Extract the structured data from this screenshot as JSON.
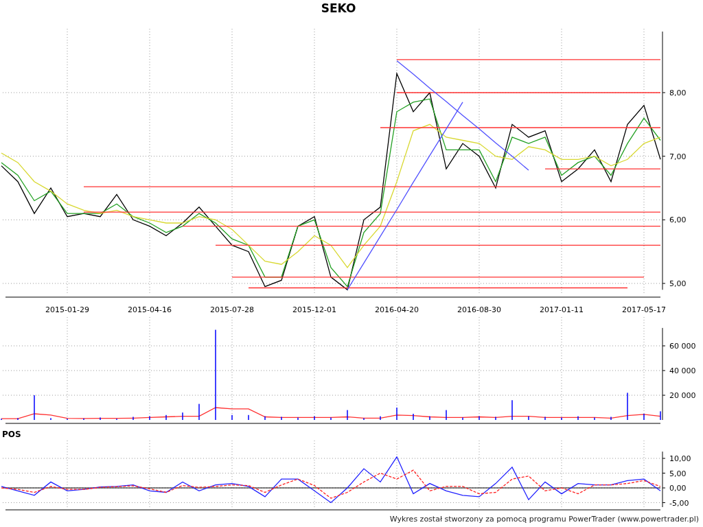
{
  "price_chart": {
    "chart_data": {
      "type": "line",
      "title": "SEKO",
      "grid": true,
      "ylim": [
        4.9,
        8.96
      ],
      "categories": [
        null,
        null,
        null,
        null,
        "2015-01-29",
        null,
        null,
        null,
        null,
        "2015-04-16",
        null,
        null,
        null,
        null,
        "2015-07-28",
        null,
        null,
        null,
        null,
        "2015-12-01",
        null,
        null,
        null,
        null,
        "2016-04-20",
        null,
        null,
        null,
        null,
        "2016-08-30",
        null,
        null,
        null,
        null,
        "2017-01-11",
        null,
        null,
        null,
        null,
        "2017-05-17",
        null
      ],
      "yticks": [
        {
          "value": 5,
          "label": "5,00"
        },
        {
          "value": 6,
          "label": "6,00"
        },
        {
          "value": 7,
          "label": "7,00"
        },
        {
          "value": 8,
          "label": "8,00"
        }
      ],
      "series": [
        {
          "color": "#000000",
          "values": [
            6.85,
            6.6,
            6.1,
            6.5,
            6.05,
            6.1,
            6.05,
            6.4,
            6.0,
            5.9,
            5.75,
            5.95,
            6.2,
            5.9,
            5.6,
            5.5,
            4.95,
            5.05,
            5.9,
            6.05,
            5.1,
            4.9,
            6.0,
            6.2,
            8.3,
            7.7,
            8.0,
            6.8,
            7.2,
            7.0,
            6.5,
            7.5,
            7.3,
            7.4,
            6.6,
            6.8,
            7.1,
            6.6,
            7.5,
            7.8,
            6.95
          ]
        },
        {
          "color": "#22a022",
          "values": [
            6.9,
            6.7,
            6.3,
            6.45,
            6.1,
            6.1,
            6.1,
            6.25,
            6.05,
            5.95,
            5.8,
            5.9,
            6.1,
            5.95,
            5.7,
            5.6,
            5.1,
            5.1,
            5.9,
            6.0,
            5.25,
            4.95,
            5.8,
            6.1,
            7.7,
            7.85,
            7.9,
            7.1,
            7.1,
            7.1,
            6.6,
            7.3,
            7.2,
            7.3,
            6.7,
            6.9,
            7.0,
            6.7,
            7.2,
            7.6,
            7.25
          ]
        },
        {
          "color": "#d8d830",
          "values": [
            7.05,
            6.9,
            6.6,
            6.45,
            6.25,
            6.15,
            6.1,
            6.15,
            6.05,
            6.0,
            5.95,
            5.95,
            6.05,
            6.0,
            5.85,
            5.6,
            5.35,
            5.3,
            5.5,
            5.75,
            5.6,
            5.25,
            5.6,
            5.9,
            6.6,
            7.4,
            7.5,
            7.3,
            7.25,
            7.2,
            7.0,
            6.95,
            7.15,
            7.1,
            6.95,
            6.95,
            7.0,
            6.85,
            6.95,
            7.2,
            7.3
          ]
        },
        {
          "color": "#ff3030",
          "values": [
            null,
            null,
            null,
            null,
            null,
            null,
            null,
            null,
            null,
            null,
            null,
            null,
            null,
            null,
            null,
            null,
            null,
            null,
            null,
            null,
            null,
            null,
            null,
            null,
            8.52,
            8.52,
            8.52,
            8.52,
            8.52,
            8.52,
            8.52,
            8.52,
            8.52,
            8.52,
            8.52,
            8.52,
            8.52,
            8.52,
            8.52,
            8.52,
            8.52
          ]
        },
        {
          "color": "#ff3030",
          "values": [
            null,
            null,
            null,
            null,
            null,
            null,
            null,
            null,
            null,
            null,
            null,
            null,
            null,
            null,
            null,
            null,
            null,
            null,
            null,
            null,
            null,
            null,
            null,
            null,
            8.0,
            8.0,
            8.0,
            8.0,
            8.0,
            8.0,
            8.0,
            8.0,
            8.0,
            8.0,
            8.0,
            8.0,
            8.0,
            8.0,
            8.0,
            8.0,
            8.0
          ]
        },
        {
          "color": "#ff3030",
          "values": [
            null,
            null,
            null,
            null,
            null,
            null,
            null,
            null,
            null,
            null,
            null,
            null,
            null,
            null,
            null,
            null,
            null,
            null,
            null,
            null,
            null,
            null,
            null,
            7.45,
            7.45,
            7.45,
            7.45,
            7.45,
            7.45,
            7.45,
            7.45,
            7.45,
            7.45,
            7.45,
            7.45,
            7.45,
            7.45,
            7.45,
            7.45,
            7.45,
            7.45
          ]
        },
        {
          "color": "#ff3030",
          "values": [
            null,
            null,
            null,
            null,
            null,
            null,
            null,
            null,
            null,
            null,
            null,
            null,
            null,
            null,
            null,
            null,
            null,
            null,
            null,
            null,
            null,
            null,
            null,
            null,
            null,
            null,
            null,
            null,
            null,
            null,
            null,
            null,
            null,
            6.8,
            6.8,
            6.8,
            6.8,
            6.8,
            6.8,
            6.8,
            6.8
          ]
        },
        {
          "color": "#ff3030",
          "values": [
            null,
            null,
            null,
            null,
            null,
            6.52,
            6.52,
            6.52,
            6.52,
            6.52,
            6.52,
            6.52,
            6.52,
            6.52,
            6.52,
            6.52,
            6.52,
            6.52,
            6.52,
            6.52,
            6.52,
            6.52,
            6.52,
            6.52,
            6.52,
            6.52,
            6.52,
            6.52,
            6.52,
            6.52,
            6.52,
            6.52,
            6.52,
            6.52,
            6.52,
            6.52,
            6.52,
            6.52,
            6.52,
            6.52,
            6.52
          ]
        },
        {
          "color": "#ff3030",
          "values": [
            null,
            null,
            null,
            null,
            null,
            6.12,
            6.12,
            6.12,
            6.12,
            6.12,
            6.12,
            6.12,
            6.12,
            6.12,
            6.12,
            6.12,
            6.12,
            6.12,
            6.12,
            6.12,
            6.12,
            6.12,
            6.12,
            6.12,
            6.12,
            6.12,
            6.12,
            6.12,
            6.12,
            6.12,
            6.12,
            6.12,
            6.12,
            6.12,
            6.12,
            6.12,
            6.12,
            6.12,
            6.12,
            6.12,
            6.12
          ]
        },
        {
          "color": "#ff3030",
          "values": [
            null,
            null,
            null,
            null,
            null,
            null,
            null,
            null,
            null,
            null,
            null,
            5.9,
            5.9,
            5.9,
            5.9,
            5.9,
            5.9,
            5.9,
            5.9,
            5.9,
            5.9,
            5.9,
            5.9,
            5.9,
            5.9,
            5.9,
            5.9,
            5.9,
            5.9,
            5.9,
            5.9,
            5.9,
            5.9,
            5.9,
            5.9,
            5.9,
            5.9,
            5.9,
            5.9,
            5.9,
            5.9
          ]
        },
        {
          "color": "#ff3030",
          "values": [
            null,
            null,
            null,
            null,
            null,
            null,
            null,
            null,
            null,
            null,
            null,
            null,
            null,
            5.6,
            5.6,
            5.6,
            5.6,
            5.6,
            5.6,
            5.6,
            5.6,
            5.6,
            5.6,
            5.6,
            5.6,
            5.6,
            5.6,
            5.6,
            5.6,
            5.6,
            5.6,
            5.6,
            5.6,
            5.6,
            5.6,
            5.6,
            5.6,
            5.6,
            5.6,
            5.6,
            5.6
          ]
        },
        {
          "color": "#ff3030",
          "values": [
            null,
            null,
            null,
            null,
            null,
            null,
            null,
            null,
            null,
            null,
            null,
            null,
            null,
            null,
            5.1,
            5.1,
            5.1,
            5.1,
            5.1,
            5.1,
            5.1,
            5.1,
            5.1,
            5.1,
            5.1,
            5.1,
            5.1,
            5.1,
            5.1,
            5.1,
            5.1,
            5.1,
            5.1,
            5.1,
            5.1,
            5.1,
            5.1,
            5.1,
            5.1,
            5.1,
            null
          ]
        },
        {
          "color": "#ff3030",
          "values": [
            null,
            null,
            null,
            null,
            null,
            null,
            null,
            null,
            null,
            null,
            null,
            null,
            null,
            null,
            null,
            4.93,
            4.93,
            4.93,
            4.93,
            4.93,
            4.93,
            4.93,
            4.93,
            4.93,
            4.93,
            4.93,
            4.93,
            4.93,
            4.93,
            4.93,
            4.93,
            4.93,
            4.93,
            4.93,
            4.93,
            4.93,
            4.93,
            4.93,
            4.93,
            null,
            null
          ]
        },
        {
          "color": "#5050ff",
          "values": [
            null,
            null,
            null,
            null,
            null,
            null,
            null,
            null,
            null,
            null,
            null,
            null,
            null,
            null,
            null,
            null,
            null,
            null,
            null,
            null,
            null,
            null,
            null,
            null,
            8.5,
            8.29,
            8.07,
            7.86,
            7.64,
            7.43,
            7.21,
            7.0,
            6.78,
            null,
            null,
            null,
            null,
            null,
            null,
            null,
            null
          ]
        },
        {
          "color": "#5050ff",
          "values": [
            null,
            null,
            null,
            null,
            null,
            null,
            null,
            null,
            null,
            null,
            null,
            null,
            null,
            null,
            null,
            null,
            null,
            null,
            null,
            null,
            null,
            4.9,
            5.32,
            5.74,
            6.16,
            6.59,
            7.01,
            7.43,
            7.85,
            null,
            null,
            null,
            null,
            null,
            null,
            null,
            null,
            null,
            null,
            null,
            null
          ]
        }
      ]
    }
  },
  "volume_chart": {
    "chart_data": {
      "type": "bar",
      "grid": true,
      "ylim": [
        0,
        74500
      ],
      "categories": [
        null,
        null,
        null,
        null,
        null,
        null,
        null,
        null,
        null,
        null,
        null,
        null,
        null,
        null,
        null,
        null,
        null,
        null,
        null,
        null,
        null,
        null,
        null,
        null,
        null,
        null,
        null,
        null,
        null,
        null,
        null,
        null,
        null,
        null,
        null,
        null,
        null,
        null,
        null,
        null,
        null
      ],
      "yticks": [
        {
          "value": 20000,
          "label": "20 000"
        },
        {
          "value": 40000,
          "label": "40 000"
        },
        {
          "value": 60000,
          "label": "60 000"
        }
      ],
      "series": [
        {
          "type": "bar",
          "color": "#0000ff",
          "values": [
            1000,
            1500,
            20000,
            1500,
            1000,
            1200,
            2000,
            1000,
            2500,
            3000,
            4000,
            6000,
            13000,
            73000,
            4000,
            4000,
            3000,
            2500,
            2000,
            3000,
            2000,
            8000,
            1500,
            3000,
            10000,
            5000,
            3000,
            8000,
            2000,
            3000,
            2500,
            16000,
            3000,
            2500,
            2000,
            3000,
            2000,
            2500,
            22000,
            5000,
            7000
          ]
        },
        {
          "type": "line",
          "color": "#ff3030",
          "values": [
            1000,
            1000,
            5000,
            4000,
            1300,
            1200,
            1300,
            1300,
            1500,
            2000,
            2500,
            3000,
            3000,
            10000,
            9000,
            9000,
            2500,
            2000,
            2000,
            2000,
            2000,
            2500,
            1500,
            1500,
            4000,
            3500,
            2500,
            2000,
            2000,
            2500,
            2000,
            3000,
            3000,
            2000,
            2000,
            2000,
            2000,
            1500,
            3500,
            4500,
            3000
          ]
        }
      ]
    }
  },
  "pos_chart": {
    "label": "POS",
    "chart_data": {
      "type": "line",
      "grid": true,
      "ylim": [
        -6.5,
        12.3
      ],
      "categories": [
        null,
        null,
        null,
        null,
        null,
        null,
        null,
        null,
        null,
        null,
        null,
        null,
        null,
        null,
        null,
        null,
        null,
        null,
        null,
        null,
        null,
        null,
        null,
        null,
        null,
        null,
        null,
        null,
        null,
        null,
        null,
        null,
        null,
        null,
        null,
        null,
        null,
        null,
        null,
        null,
        null
      ],
      "yticks": [
        {
          "value": -5,
          "label": "-5,00"
        },
        {
          "value": 0,
          "label": "0,00"
        },
        {
          "value": 5,
          "label": "5,00"
        },
        {
          "value": 10,
          "label": "10,00"
        }
      ],
      "series": [
        {
          "color": "#2020ff",
          "line_style": "solid",
          "values": [
            0.5,
            -1,
            -2.5,
            2,
            -1,
            -0.5,
            0.3,
            0.5,
            1,
            -1,
            -1.5,
            2,
            -1,
            1,
            1.5,
            0.5,
            -3,
            3,
            3,
            -1,
            -5,
            0,
            6.5,
            2,
            10.5,
            -2,
            1.5,
            -1,
            -2.5,
            -3,
            1.5,
            7,
            -4,
            2,
            -2,
            1.5,
            1,
            1,
            2.5,
            3,
            -1
          ]
        },
        {
          "color": "#ff2020",
          "line_style": "dashed",
          "values": [
            0,
            -0.5,
            -1.5,
            0.5,
            -0.5,
            -0.5,
            0.2,
            0.4,
            0.7,
            -0.3,
            -1.5,
            0.8,
            0.2,
            0.5,
            1,
            0.8,
            -1.5,
            1,
            3,
            0.8,
            -3.5,
            -1.5,
            2,
            5,
            3,
            6,
            -1,
            0.5,
            0.5,
            -2,
            -1.5,
            3,
            4,
            -1,
            0,
            -2,
            1,
            1,
            1.5,
            2.5,
            0.5
          ]
        }
      ]
    }
  },
  "footer": "Wykres został stworzony za pomocą programu PowerTrader (www.powertrader.pl)"
}
